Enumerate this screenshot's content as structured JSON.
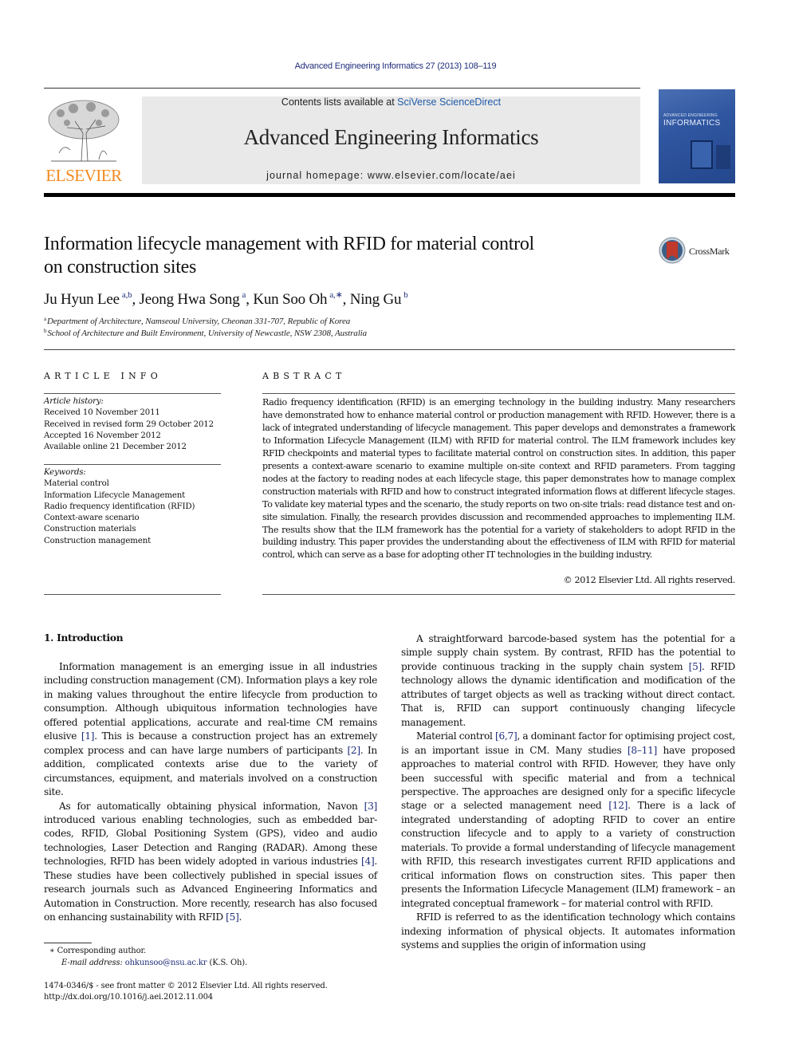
{
  "journal_ref": "Advanced Engineering Informatics 27 (2013) 108–119",
  "header": {
    "publisher_logo_text": "ELSEVIER",
    "contents_prefix": "Contents lists available at ",
    "contents_link": "SciVerse ScienceDirect",
    "journal_title": "Advanced Engineering Informatics",
    "homepage": "journal homepage: www.elsevier.com/locate/aei",
    "cover": {
      "small_title": "ADVANCED ENGINEERING",
      "title": "INFORMATICS"
    }
  },
  "crossmark": {
    "label": "CrossMark"
  },
  "article": {
    "title_line1": "Information lifecycle management with RFID for material control",
    "title_line2": "on construction sites",
    "authors": [
      {
        "name": "Ju Hyun Lee",
        "sup": "a,b",
        "sep": ", "
      },
      {
        "name": "Jeong Hwa Song",
        "sup": "a",
        "sep": ", "
      },
      {
        "name": "Kun Soo Oh",
        "sup": "a,∗",
        "sep": ", "
      },
      {
        "name": "Ning Gu",
        "sup": "b",
        "sep": ""
      }
    ],
    "affiliations": [
      {
        "mark": "a",
        "text": "Department of Architecture, Namseoul University, Cheonan 331-707, Republic of Korea"
      },
      {
        "mark": "b",
        "text": "School of Architecture and Built Environment, University of Newcastle, NSW 2308, Australia"
      }
    ]
  },
  "article_info": {
    "heading": "ARTICLE INFO",
    "history_label": "Article history:",
    "history": [
      "Received 10 November 2011",
      "Received in revised form 29 October 2012",
      "Accepted 16 November 2012",
      "Available online 21 December 2012"
    ],
    "keywords_label": "Keywords:",
    "keywords": [
      "Material control",
      "Information Lifecycle Management",
      "Radio frequency identification (RFID)",
      "Context-aware scenario",
      "Construction materials",
      "Construction management"
    ]
  },
  "abstract": {
    "heading": "ABSTRACT",
    "text": "Radio frequency identification (RFID) is an emerging technology in the building industry. Many researchers have demonstrated how to enhance material control or production management with RFID. However, there is a lack of integrated understanding of lifecycle management. This paper develops and demonstrates a framework to Information Lifecycle Management (ILM) with RFID for material control. The ILM framework includes key RFID checkpoints and material types to facilitate material control on construction sites. In addition, this paper presents a context-aware scenario to examine multiple on-site context and RFID parameters. From tagging nodes at the factory to reading nodes at each lifecycle stage, this paper demonstrates how to manage complex construction materials with RFID and how to construct integrated information flows at different lifecycle stages. To validate key material types and the scenario, the study reports on two on-site trials: read distance test and on-site simulation. Finally, the research provides discussion and recommended approaches to implementing ILM. The results show that the ILM framework has the potential for a variety of stakeholders to adopt RFID in the building industry. This paper provides the understanding about the effectiveness of ILM with RFID for material control, which can serve as a base for adopting other IT technologies in the building industry.",
    "copyright": "© 2012 Elsevier Ltd. All rights reserved."
  },
  "body": {
    "section_heading": "1. Introduction",
    "left_column": [
      [
        {
          "t": "Information management is an emerging issue in all industries including construction management (CM). Information plays a key role in making values throughout the entire lifecycle from production to consumption. Although ubiquitous information technologies have offered potential applications, accurate and real-time CM remains elusive "
        },
        {
          "c": "[1]"
        },
        {
          "t": ". This is because a construction project has an extremely complex process and can have large numbers of participants "
        },
        {
          "c": "[2]"
        },
        {
          "t": ". In addition, complicated contexts arise due to the variety of circumstances, equipment, and materials involved on a construction site."
        }
      ],
      [
        {
          "t": "As for automatically obtaining physical information, Navon "
        },
        {
          "c": "[3]"
        },
        {
          "t": " introduced various enabling technologies, such as embedded bar-codes, RFID, Global Positioning System (GPS), video and audio technologies, Laser Detection and Ranging (RADAR). Among these technologies, RFID has been widely adopted in various industries "
        },
        {
          "c": "[4]"
        },
        {
          "t": ". These studies have been collectively published in special issues of research journals such as Advanced Engineering Informatics and Automation in Construction. More recently, research has also focused on enhancing sustainability with RFID "
        },
        {
          "c": "[5]"
        },
        {
          "t": "."
        }
      ]
    ],
    "right_column": [
      [
        {
          "t": "A straightforward barcode-based system has the potential for a simple supply chain system. By contrast, RFID has the potential to provide continuous tracking in the supply chain system "
        },
        {
          "c": "[5]"
        },
        {
          "t": ". RFID technology allows the dynamic identification and modification of the attributes of target objects as well as tracking without direct contact. That is, RFID can support continuously changing lifecycle management."
        }
      ],
      [
        {
          "t": "Material control "
        },
        {
          "c": "[6,7]"
        },
        {
          "t": ", a dominant factor for optimising project cost, is an important issue in CM. Many studies "
        },
        {
          "c": "[8–11]"
        },
        {
          "t": " have proposed approaches to material control with RFID. However, they have only been successful with specific material and from a technical perspective. The approaches are designed only for a specific lifecycle stage or a selected management need "
        },
        {
          "c": "[12]"
        },
        {
          "t": ". There is a lack of integrated understanding of adopting RFID to cover an entire construction lifecycle and to apply to a variety of construction materials. To provide a formal understanding of lifecycle management with RFID, this research investigates current RFID applications and critical information flows on construction sites. This paper then presents the Information Lifecycle Management (ILM) framework – an integrated conceptual framework – for material control with RFID."
        }
      ],
      [
        {
          "t": "RFID is referred to as the identification technology which contains indexing information of physical objects. It automates information systems and supplies the origin of information using"
        }
      ]
    ]
  },
  "footnotes": {
    "corresponding": "∗ Corresponding author.",
    "email_label": "E-mail address: ",
    "email": "ohkunsoo@nsu.ac.kr",
    "email_suffix": " (K.S. Oh).",
    "issn_line": "1474-0346/$ - see front matter © 2012 Elsevier Ltd. All rights reserved.",
    "doi": "http://dx.doi.org/10.1016/j.aei.2012.11.004"
  },
  "colors": {
    "link": "#1f2d7a",
    "elsevier_orange": "#f28a1e",
    "header_box": "#e9e9e9",
    "cover_blue": "#2f56a0",
    "crossmark_red": "#c0392b"
  }
}
